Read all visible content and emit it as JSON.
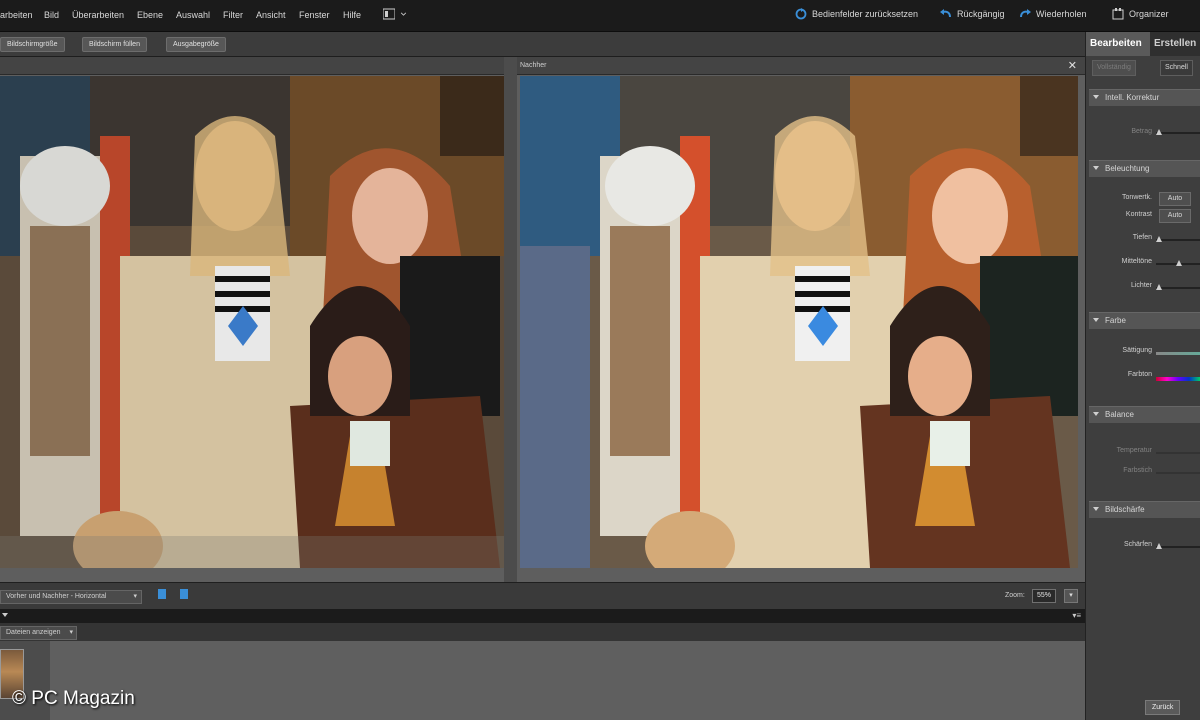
{
  "menubar": {
    "menus": [
      "arbeiten",
      "Bild",
      "Überarbeiten",
      "Ebene",
      "Auswahl",
      "Filter",
      "Ansicht",
      "Fenster",
      "Hilfe"
    ],
    "reset_label": "Bedienfelder zurücksetzen",
    "undo_label": "Rückgängig",
    "redo_label": "Wiederholen",
    "organizer_label": "Organizer"
  },
  "optionbar": {
    "buttons": [
      "Bildschirmgröße",
      "Bildschirm füllen",
      "Ausgabegröße"
    ]
  },
  "panes": {
    "after_title": "Nachher"
  },
  "viewbar": {
    "view_mode": "Vorher und Nachher - Horizontal",
    "zoom_label": "Zoom:",
    "zoom_value": "55%"
  },
  "bin": {
    "filter": "Dateien anzeigen"
  },
  "rightpanel": {
    "tab_active": "Bearbeiten",
    "tab_inactive": "Erstellen",
    "subtab_1": "Vollständig",
    "subtab_2": "Schnell",
    "sections": [
      "Intell. Korrektur",
      "Beleuchtung",
      "Farbe",
      "Balance",
      "Bildschärfe"
    ],
    "labels": {
      "betrag": "Betrag",
      "tonwert": "Tonwertk.",
      "kontrast": "Kontrast",
      "tiefen": "Tiefen",
      "mitteltoene": "Mitteltöne",
      "lichter": "Lichter",
      "saettigung": "Sättigung",
      "farbton": "Farbton",
      "temperatur": "Temperatur",
      "farbstich": "Farbstich",
      "schaerfen": "Schärfen"
    },
    "auto_label": "Auto",
    "reset_button": "Zurück"
  },
  "watermark": "© PC Magazin",
  "colors": {
    "accent": "#3a8fd8",
    "panel": "#3e3e3e",
    "workspace": "#5e5e5e"
  }
}
